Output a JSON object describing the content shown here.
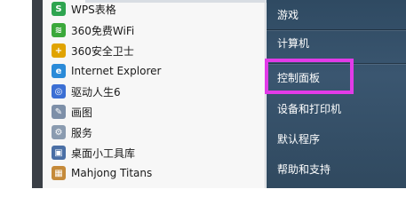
{
  "programs": [
    {
      "label": "WPS表格",
      "icon": "wps-sheet-icon",
      "color": "#2ea44f",
      "glyph": "S"
    },
    {
      "label": "360免费WiFi",
      "icon": "wifi-icon",
      "color": "#3aa83a",
      "glyph": "≋"
    },
    {
      "label": "360安全卫士",
      "icon": "shield-icon",
      "color": "#e0a300",
      "glyph": "+"
    },
    {
      "label": "Internet Explorer",
      "icon": "ie-icon",
      "color": "#2a8ad8",
      "glyph": "e"
    },
    {
      "label": "驱动人生6",
      "icon": "driver-icon",
      "color": "#3b6fd4",
      "glyph": "◎"
    },
    {
      "label": "画图",
      "icon": "paint-icon",
      "color": "#7d8fa8",
      "glyph": "✎"
    },
    {
      "label": "服务",
      "icon": "services-icon",
      "color": "#8a9bb0",
      "glyph": "⚙"
    },
    {
      "label": "桌面小工具库",
      "icon": "gadgets-icon",
      "color": "#4a6fa5",
      "glyph": "▣"
    },
    {
      "label": "Mahjong Titans",
      "icon": "mahjong-icon",
      "color": "#c58a3a",
      "glyph": "▦"
    }
  ],
  "places": [
    {
      "label": "游戏"
    },
    {
      "label": "计算机"
    },
    {
      "label": "控制面板"
    },
    {
      "label": "设备和打印机"
    },
    {
      "label": "默认程序"
    },
    {
      "label": "帮助和支持"
    }
  ],
  "colors": {
    "highlight": "#e23be8",
    "places_bg": "#34506a",
    "programs_bg": "#f7f7f7"
  }
}
